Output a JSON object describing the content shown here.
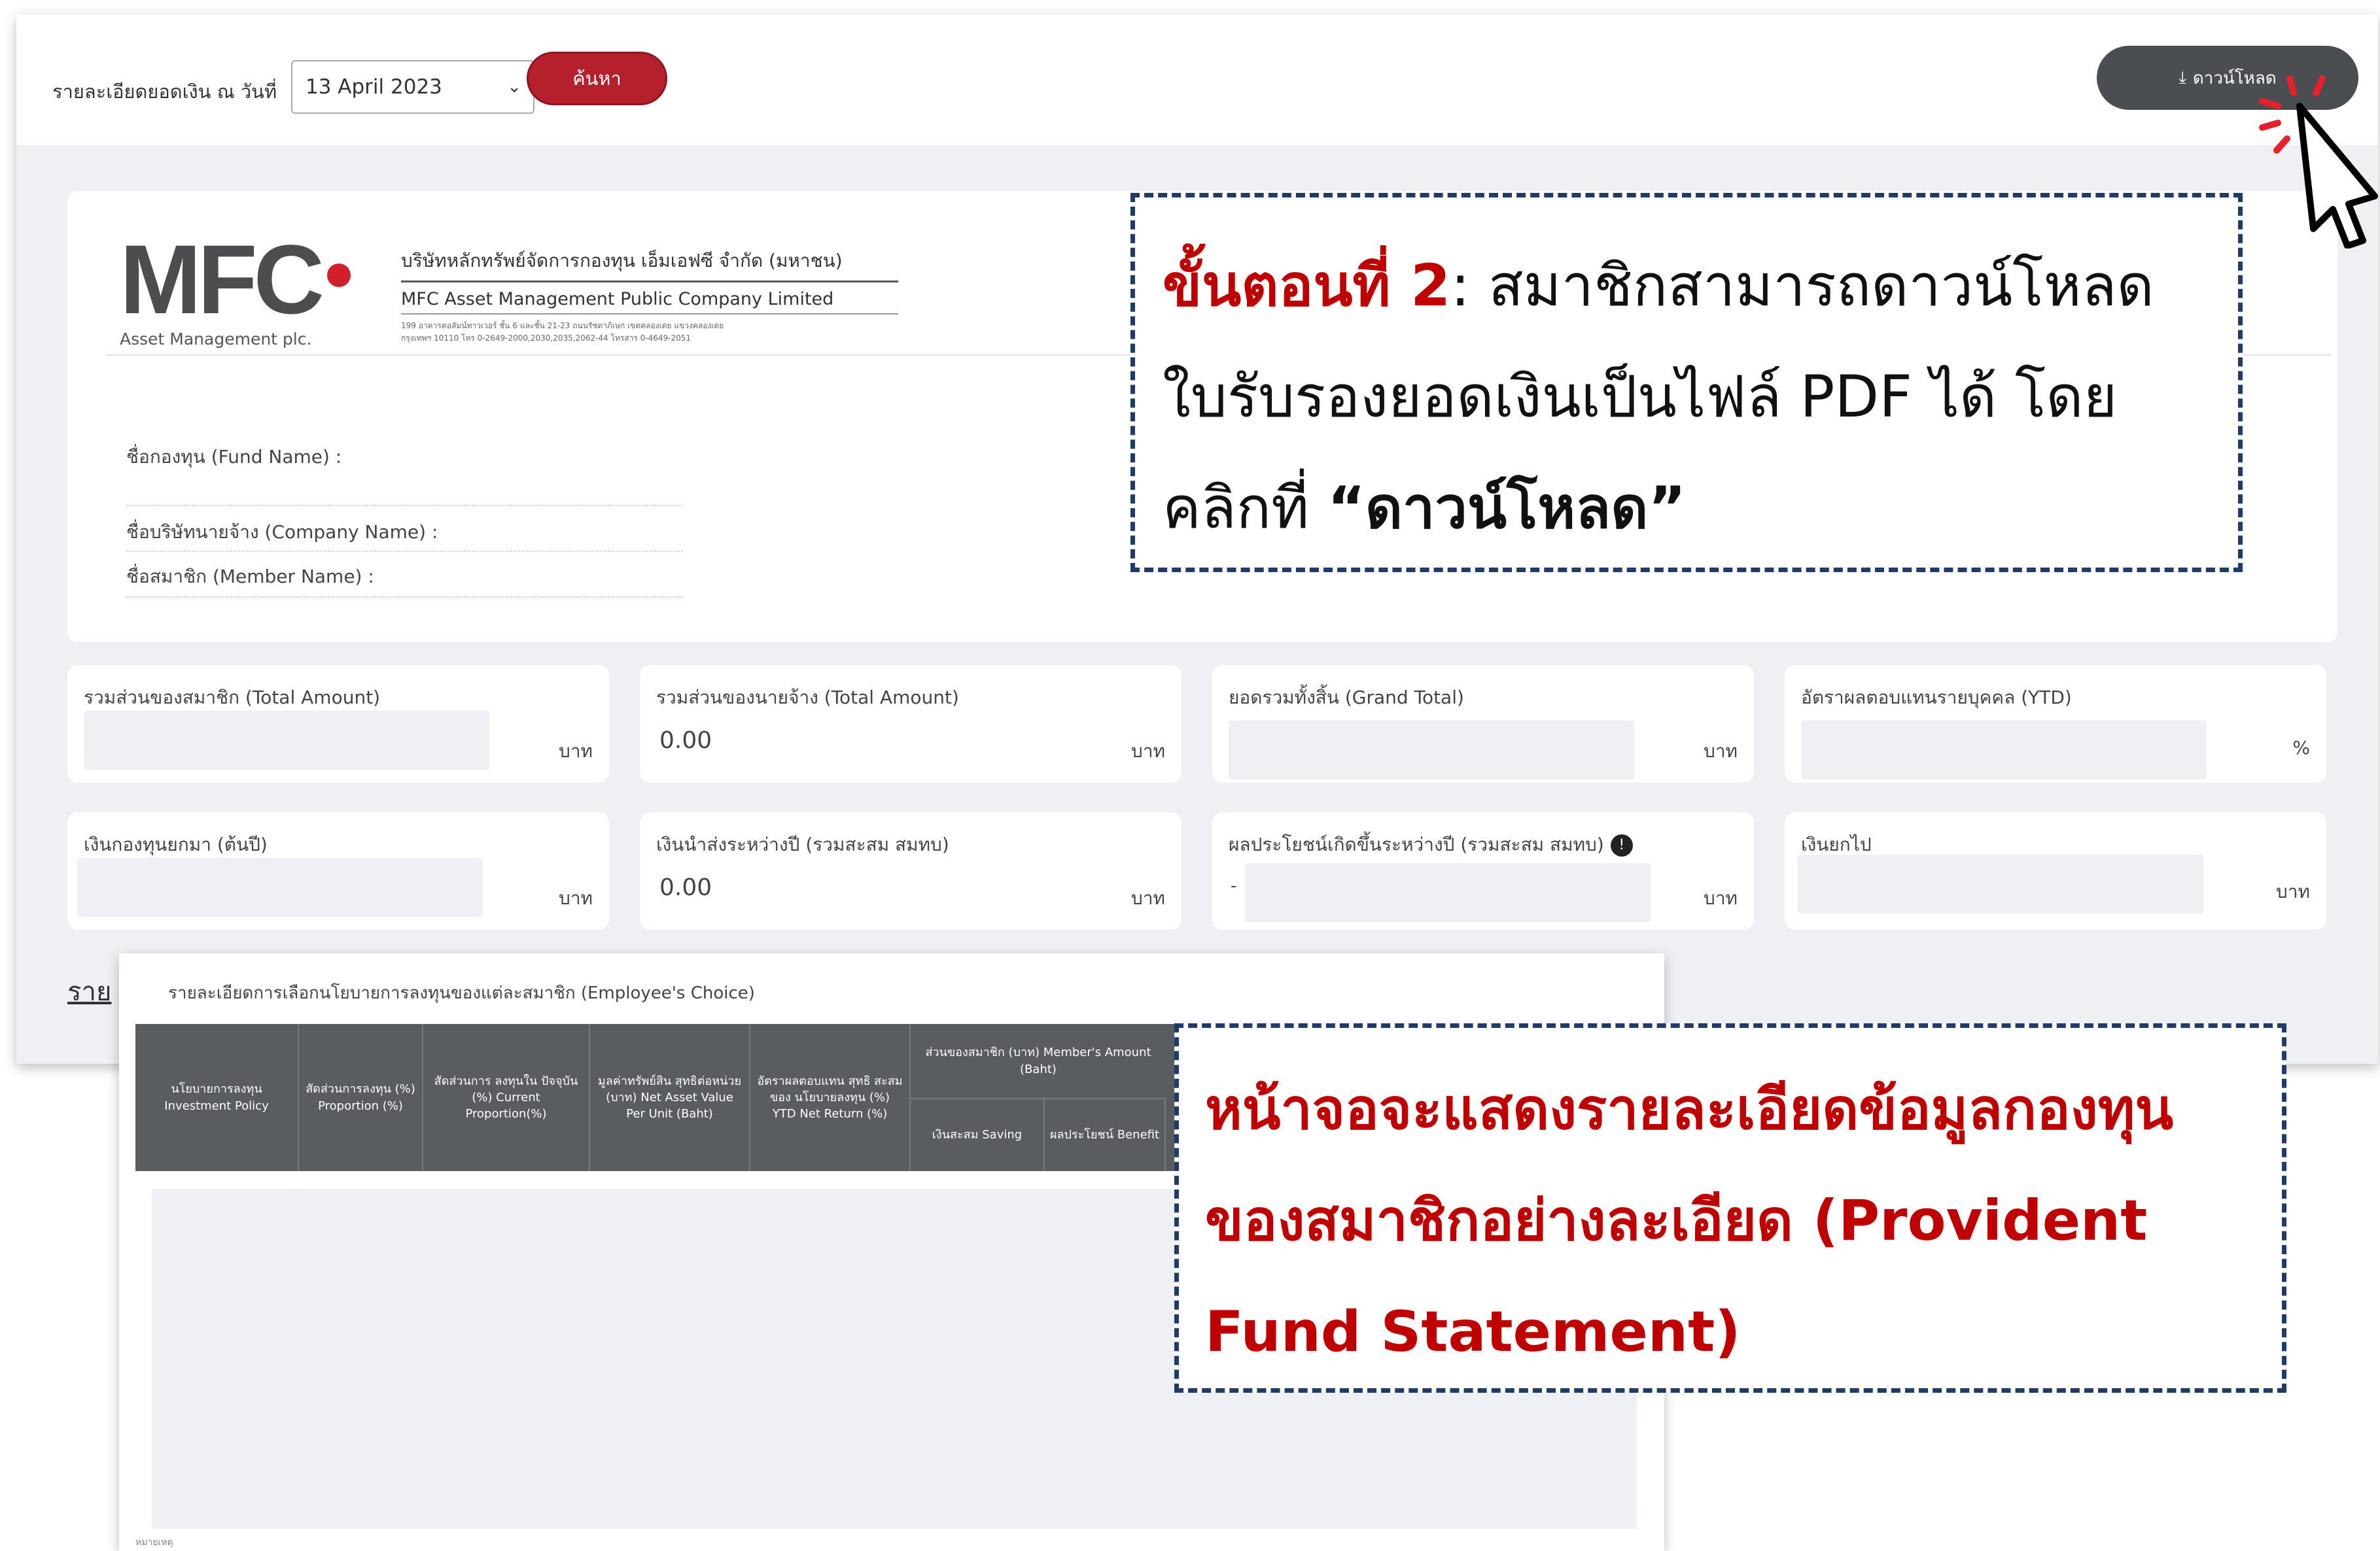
{
  "toolbar": {
    "date_label": "รายละเอียดยอดเงิน ณ วันที่",
    "date_value": "13 April 2023",
    "search_label": "ค้นหา",
    "download_label": "ดาวน์โหลด"
  },
  "company": {
    "logo_text": "MFC",
    "logo_sub": "Asset Management plc.",
    "name_th": "บริษัทหลักทรัพย์จัดการกองทุน เอ็มเอฟซี จำกัด (มหาชน)",
    "name_en": "MFC Asset Management Public Company Limited",
    "address_line1": "199 อาคารคอลัมน์ทาวเวอร์ ชั้น 6 และชั้น 21-23 ถนนรัชดาภิเษก เขตคลองเตย แขวงคลองเตย",
    "address_line2": "กรุงเทพฯ 10110 โทร 0-2649-2000,2030,2035,2062-44 โทรสาร 0-4649-2051"
  },
  "fields": {
    "fund_name": "ชื่อกองทุน (Fund Name) :",
    "company_name": "ชื่อบริษัทนายจ้าง (Company Name) :",
    "member_name": "ชื่อสมาชิก (Member Name) :"
  },
  "amounts": {
    "member_total_label": "รวมส่วนของสมาชิก (Total Amount)",
    "member_total_unit": "บาท",
    "employer_total_label": "รวมส่วนของนายจ้าง (Total Amount)",
    "employer_total_value": "0.00",
    "employer_total_unit": "บาท",
    "grand_total_label": "ยอดรวมทั้งสิ้น (Grand Total)",
    "grand_total_unit": "บาท",
    "ytd_label": "อัตราผลตอบแทนรายบุคคล (YTD)",
    "ytd_unit": "%",
    "bf_label": "เงินกองทุนยกมา (ต้นปี)",
    "bf_unit": "บาท",
    "contrib_label": "เงินนำส่งระหว่างปี (รวมสะสม สมทบ)",
    "contrib_value": "0.00",
    "contrib_unit": "บาท",
    "benefit_label": "ผลประโยชน์เกิดขึ้นระหว่างปี (รวมสะสม สมทบ)",
    "benefit_value": "-",
    "benefit_unit": "บาท",
    "cf_label": "เงินยกไป",
    "cf_unit": "บาท"
  },
  "section_heading": "ราย",
  "employee_choice": {
    "title": "รายละเอียดการเลือกนโยบายการลงทุนของแต่ละสมาชิก (Employee's Choice)",
    "columns": [
      "นโยบายการลงทุน Investment Policy",
      "สัดส่วนการลงทุน (%) Proportion (%)",
      "สัดส่วนการ ลงทุนใน ปัจจุบัน (%) Current Proportion(%)",
      "มูลค่าทรัพย์สิน สุทธิต่อหน่วย (บาท) Net Asset Value Per Unit (Baht)",
      "อัตราผลตอบแทน สุทธิ สะสมของ นโยบายลงทุน (%) YTD Net Return (%)"
    ],
    "group_header": "ส่วนของสมาชิก (บาท) Member's Amount (Baht)",
    "sub_columns": [
      "เงินสะสม Saving",
      "ผลประโยชน์ Benefit"
    ],
    "footer": "หมายเหตุ"
  },
  "callouts": {
    "step_prefix": "ขั้นตอนที่ 2",
    "step_line1": ": สมาชิกสามารถดาวน์โหลด",
    "step_line2": "ใบรับรองยอดเงินเป็นไฟล์ PDF ได้ โดย",
    "step_line3_pre": "คลิกที่ ",
    "step_line3_bold": "“ดาวน์โหลด”",
    "info_line1": "หน้าจอจะแสดงรายละเอียดข้อมูลกองทุน",
    "info_line2": "ของสมาชิกอย่างละเอียด (Provident",
    "info_line3": "Fund Statement)"
  },
  "colors": {
    "brand_red": "#b5202c",
    "callout_red": "#c00000",
    "callout_border": "#1f3b68",
    "download_bg": "#4a4d52",
    "table_header": "#595c61"
  }
}
